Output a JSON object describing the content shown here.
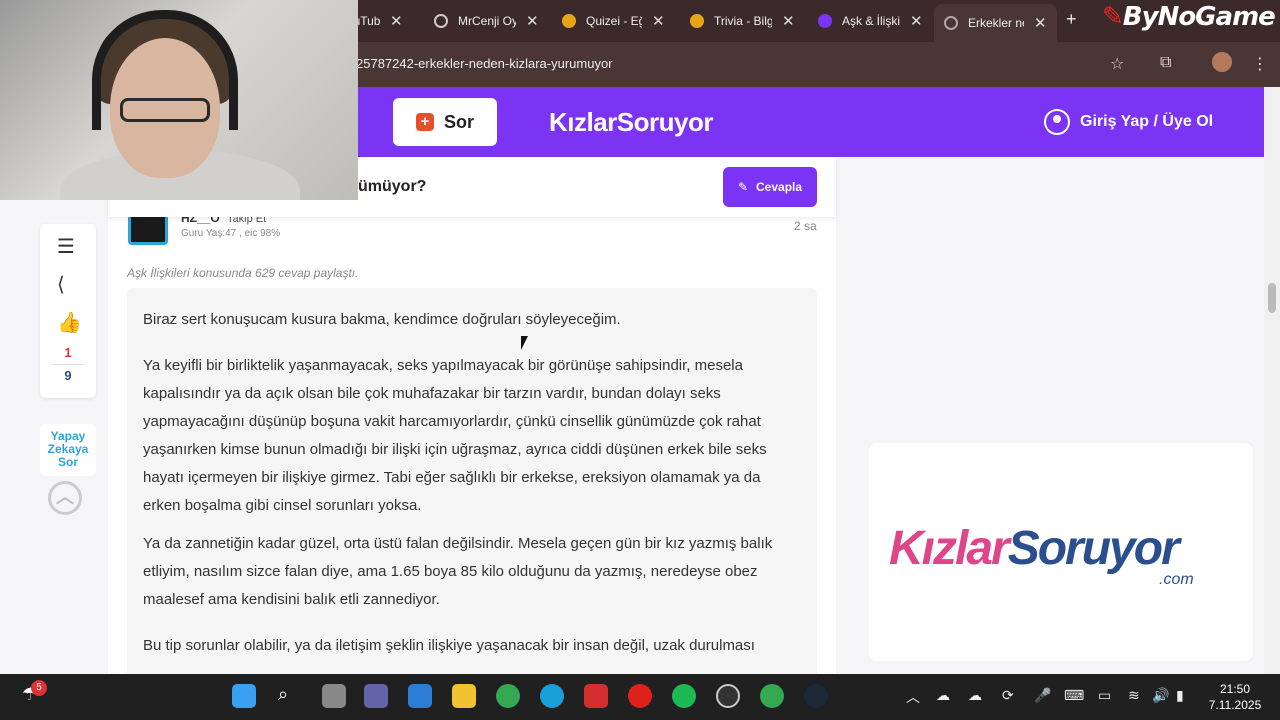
{
  "browser": {
    "tabs": [
      {
        "label": "YouTube",
        "color": "#e33"
      },
      {
        "label": "MrCenji Oyun",
        "color": "#999"
      },
      {
        "label": "Quizei - Eğlen",
        "color": "#e8a317"
      },
      {
        "label": "Trivia - Bilgi",
        "color": "#e8a317"
      },
      {
        "label": "Aşk & İlişki",
        "color": "#7b33f4"
      },
      {
        "label": "Erkekler neden",
        "color": "#aaa"
      }
    ],
    "url": "25787242-erkekler-neden-kizlara-yurumuyor",
    "brand_prefix": "By",
    "brand_rest": "NoGame"
  },
  "site": {
    "ask_label": "Sor",
    "logo": "KızlarSoruyor",
    "login_label": "Giriş Yap / Üye Ol"
  },
  "question": {
    "title_visible": "ümüyor?",
    "answer_button": "Cevapla"
  },
  "answer": {
    "username": "HZ__O",
    "follow_label": "Takip Et",
    "meta": "Guru Yaş:47 , eic 98%",
    "time": "2 sa",
    "topic_note": "Aşk İlişkileri konusunda 629 cevap paylaştı.",
    "paragraphs": [
      "Biraz sert konuşucam kusura bakma, kendimce doğruları söyleyeceğim.",
      "Ya keyifli bir birliktelik yaşanmayacak, seks yapılmayacak bir görünüşe sahipsindir, mesela kapalısındır ya da açık olsan bile çok muhafazakar bir tarzın vardır, bundan dolayı seks yapmayacağını düşünüp boşuna vakit harcamıyorlardır, çünkü cinsellik günümüzde çok rahat yaşanırken kimse bunun olmadığı bir ilişki için uğraşmaz, ayrıca ciddi düşünen erkek bile seks hayatı içermeyen bir ilişkiye girmez. Tabi eğer sağlıklı bir erkekse, ereksiyon olamamak ya da erken boşalma gibi cinsel sorunları yoksa.",
      "Ya da zannetiğin kadar güzel, orta üstü falan değilsindir. Mesela geçen gün bir kız yazmış balık etliyim, nasılım sizce falan diye, ama 1.65 boya 85 kilo olduğunu da yazmış, neredeyse obez maalesef ama kendisini balık etli zannediyor.",
      "Bu tip sorunlar olabilir, ya da iletişim şeklin ilişkiye yaşanacak bir insan değil, uzak durulması"
    ]
  },
  "sidebar": {
    "like_count": "1",
    "other_count": "9",
    "ai_label": "Yapay Zekaya Sor"
  },
  "ad": {
    "logo_part1": "Kızlar",
    "logo_part2": "Soruyor",
    "logo_com": ".com"
  },
  "taskbar": {
    "weather_badge": "5",
    "time": "21:50",
    "date": "7.11.2025"
  }
}
